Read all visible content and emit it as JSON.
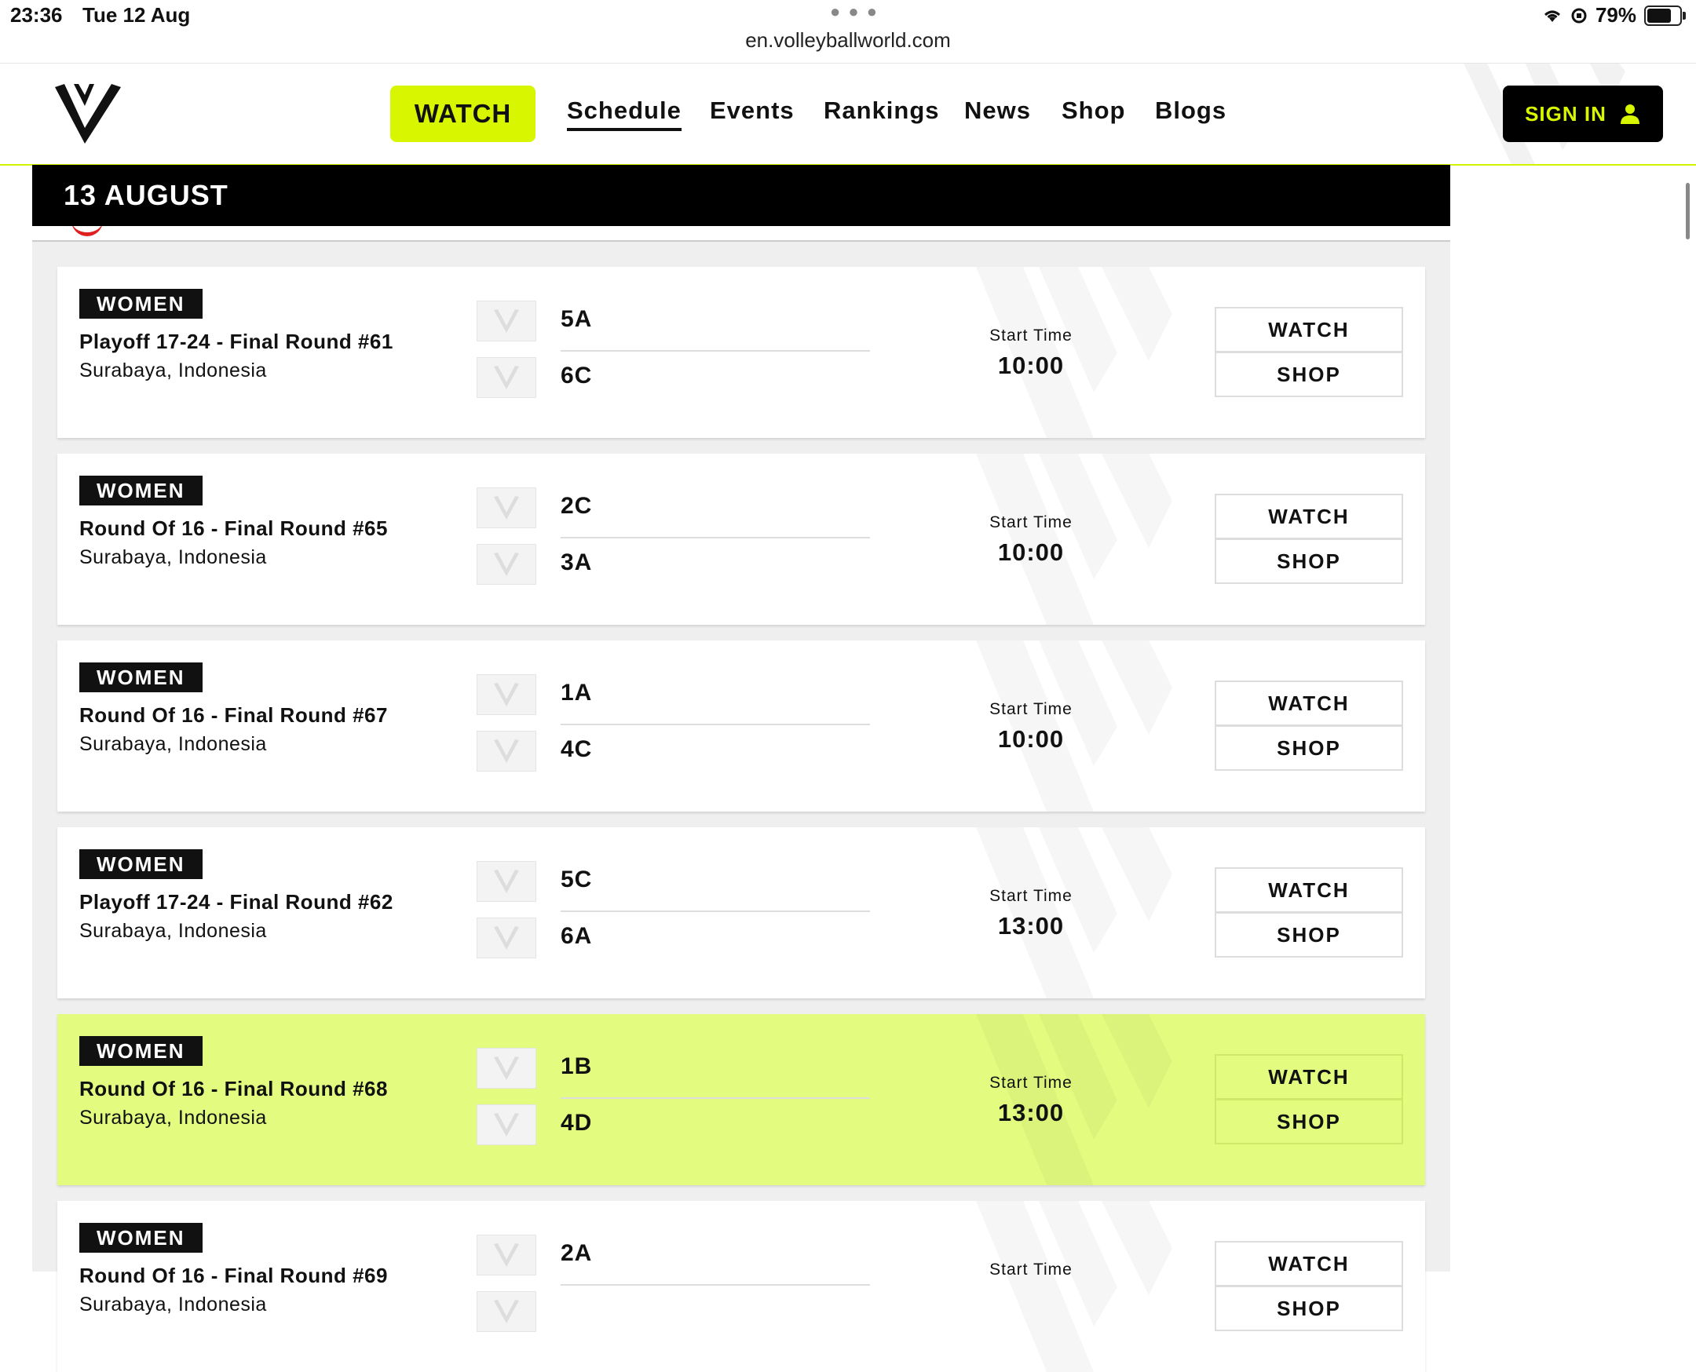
{
  "status_bar": {
    "time": "23:36",
    "date": "Tue 12 Aug",
    "url": "en.volleyballworld.com",
    "battery": "79%"
  },
  "header": {
    "watch_label": "WATCH",
    "nav": [
      "Schedule",
      "Events",
      "Rankings",
      "News",
      "Shop",
      "Blogs"
    ],
    "active_nav": "Schedule",
    "sign_in_label": "SIGN IN"
  },
  "colors": {
    "accent": "#d7f600",
    "highlight_card": "#e3fc80",
    "dark": "#000000"
  },
  "date_heading": "13 AUGUST",
  "matches": [
    {
      "category": "WOMEN",
      "name": "Playoff 17-24 - Final Round #61",
      "location": "Surabaya, Indonesia",
      "team1": "5A",
      "team2": "6C",
      "start_label": "Start Time",
      "start_time": "10:00",
      "watch_label": "WATCH",
      "shop_label": "SHOP"
    },
    {
      "category": "WOMEN",
      "name": "Round Of 16 - Final Round #65",
      "location": "Surabaya, Indonesia",
      "team1": "2C",
      "team2": "3A",
      "start_label": "Start Time",
      "start_time": "10:00",
      "watch_label": "WATCH",
      "shop_label": "SHOP"
    },
    {
      "category": "WOMEN",
      "name": "Round Of 16 - Final Round #67",
      "location": "Surabaya, Indonesia",
      "team1": "1A",
      "team2": "4C",
      "start_label": "Start Time",
      "start_time": "10:00",
      "watch_label": "WATCH",
      "shop_label": "SHOP"
    },
    {
      "category": "WOMEN",
      "name": "Playoff 17-24 - Final Round #62",
      "location": "Surabaya, Indonesia",
      "team1": "5C",
      "team2": "6A",
      "start_label": "Start Time",
      "start_time": "13:00",
      "watch_label": "WATCH",
      "shop_label": "SHOP"
    },
    {
      "category": "WOMEN",
      "name": "Round Of 16 - Final Round #68",
      "location": "Surabaya, Indonesia",
      "team1": "1B",
      "team2": "4D",
      "start_label": "Start Time",
      "start_time": "13:00",
      "watch_label": "WATCH",
      "shop_label": "SHOP",
      "highlighted": true
    },
    {
      "category": "WOMEN",
      "name": "Round Of 16 - Final Round #69",
      "location": "Surabaya, Indonesia",
      "team1": "2A",
      "team2": "",
      "start_label": "Start Time",
      "start_time": "",
      "watch_label": "WATCH",
      "shop_label": "SHOP"
    }
  ]
}
